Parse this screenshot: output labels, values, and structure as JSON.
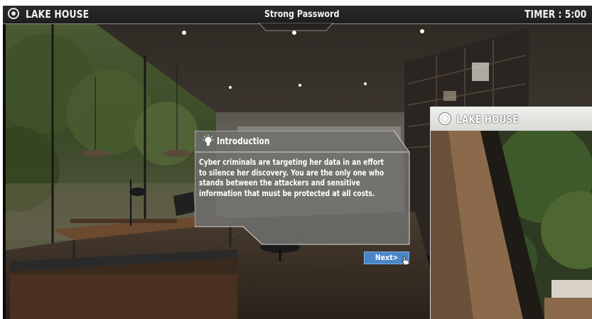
{
  "hud": {
    "brand": "LAKE HOUSE",
    "title": "Strong Password",
    "timer": "TIMER : 5:00"
  },
  "dialog": {
    "title": "Introduction",
    "body": "Cyber criminals are targeting her data in an effort to silence her discovery. You are the only one who stands between the attackers and sensitive information that must be protected at all costs.",
    "next_label": "Next>"
  },
  "side_panel": {
    "brand": "LAKE HOUSE"
  },
  "icons": {
    "logo": "camera-lens-icon",
    "dialog": "lightbulb-icon",
    "cursor": "hand-pointer-icon"
  },
  "colors": {
    "next_button": "#4a86c8",
    "dialog_fill": "#6e6e6c",
    "hud_bar": "#242321"
  }
}
